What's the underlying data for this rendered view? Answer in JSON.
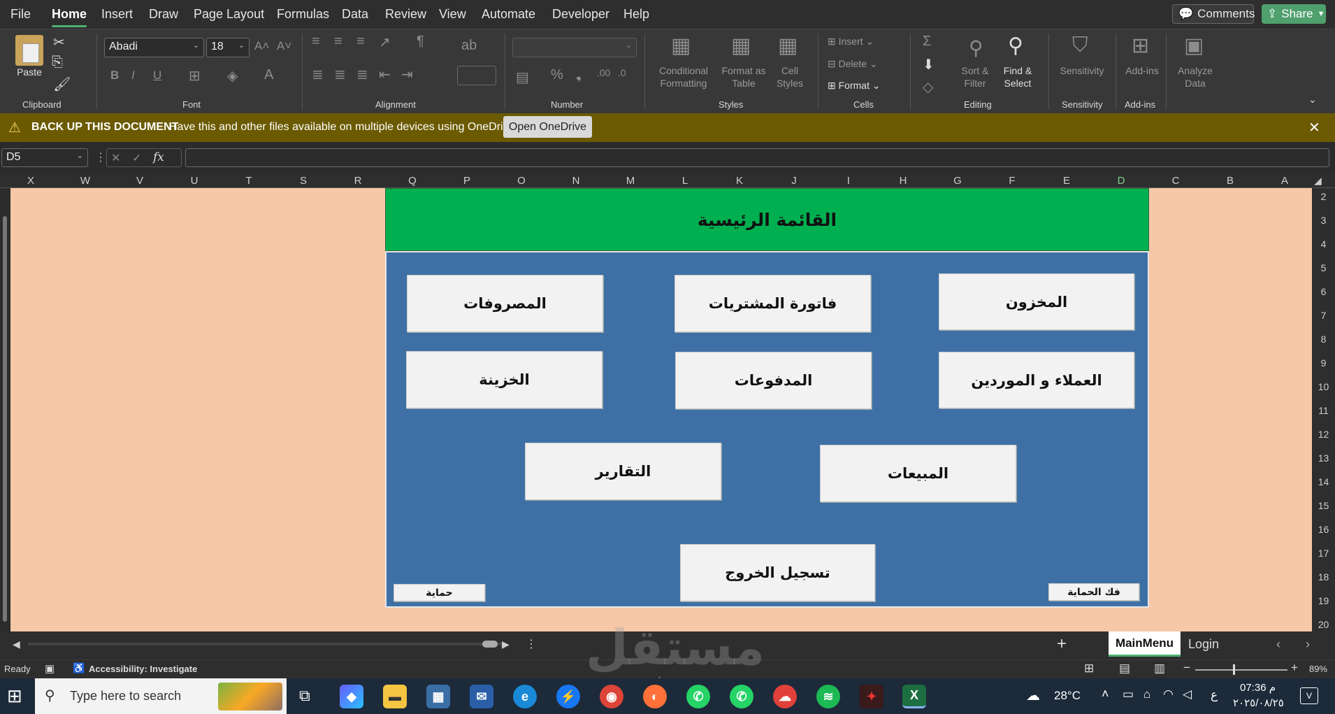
{
  "menu": {
    "tabs": [
      "File",
      "Home",
      "Insert",
      "Draw",
      "Page Layout",
      "Formulas",
      "Data",
      "Review",
      "View",
      "Automate",
      "Developer",
      "Help"
    ],
    "active": "Home",
    "comments_label": "Comments",
    "share_label": "Share"
  },
  "ribbon": {
    "paste_label": "Paste",
    "font_name": "Abadi",
    "font_size": "18",
    "groups": {
      "clipboard": "Clipboard",
      "font": "Font",
      "alignment": "Alignment",
      "number": "Number",
      "styles": "Styles",
      "cells": "Cells",
      "editing": "Editing",
      "sensitivity": "Sensitivity",
      "addins": "Add-ins"
    },
    "styles": {
      "conditional_formatting": [
        "Conditional",
        "Formatting"
      ],
      "format_as_table": [
        "Format as",
        "Table"
      ],
      "cell_styles": [
        "Cell",
        "Styles"
      ]
    },
    "cells": {
      "insert": "Insert",
      "delete": "Delete",
      "format": "Format"
    },
    "editing": {
      "sort_filter": [
        "Sort &",
        "Filter"
      ],
      "find_select": [
        "Find &",
        "Select"
      ]
    },
    "sensitivity_label": "Sensitivity",
    "addins_label": "Add-ins",
    "analyze": [
      "Analyze",
      "Data"
    ]
  },
  "warning": {
    "title": "BACK UP THIS DOCUMENT",
    "message": "Have this and other files available on multiple devices using OneDrive.",
    "button": "Open OneDrive"
  },
  "formula_bar": {
    "name_box": "D5",
    "fx": "fx",
    "content": ""
  },
  "grid": {
    "columns": [
      "X",
      "W",
      "V",
      "U",
      "T",
      "S",
      "R",
      "Q",
      "P",
      "O",
      "N",
      "M",
      "L",
      "K",
      "J",
      "I",
      "H",
      "G",
      "F",
      "E",
      "D",
      "C",
      "B",
      "A"
    ],
    "selected_column": "D",
    "rows": [
      "2",
      "3",
      "4",
      "5",
      "6",
      "7",
      "8",
      "9",
      "10",
      "11",
      "12",
      "13",
      "14",
      "15",
      "16",
      "17",
      "18",
      "19",
      "20"
    ]
  },
  "main_menu": {
    "title": "القائمة الرئيسية",
    "buttons": {
      "inventory": "المخزون",
      "purchase_invoice": "فاتورة المشتريات",
      "expenses": "المصروفات",
      "customers_suppliers": "العملاء و الموردين",
      "payments": "المدفوعات",
      "treasury": "الخزينة",
      "sales": "المبيعات",
      "reports": "التقارير",
      "logout": "تسجيل الخروج",
      "unprotect": "فك الحماية",
      "protect": "حماية"
    }
  },
  "sheet_tabs": {
    "tabs": [
      "MainMenu",
      "Login"
    ],
    "active": "MainMenu"
  },
  "status": {
    "ready": "Ready",
    "accessibility": "Accessibility: Investigate",
    "zoom": "89%"
  },
  "watermark": {
    "arabic": "مستقل",
    "latin": "mostaql.com"
  },
  "taskbar": {
    "search_placeholder": "Type here to search",
    "temperature": "28°C",
    "lang": "ع",
    "time": "07:36 م",
    "date": "٢٠٢٥/٠٨/٢٥",
    "notifications": "V"
  }
}
